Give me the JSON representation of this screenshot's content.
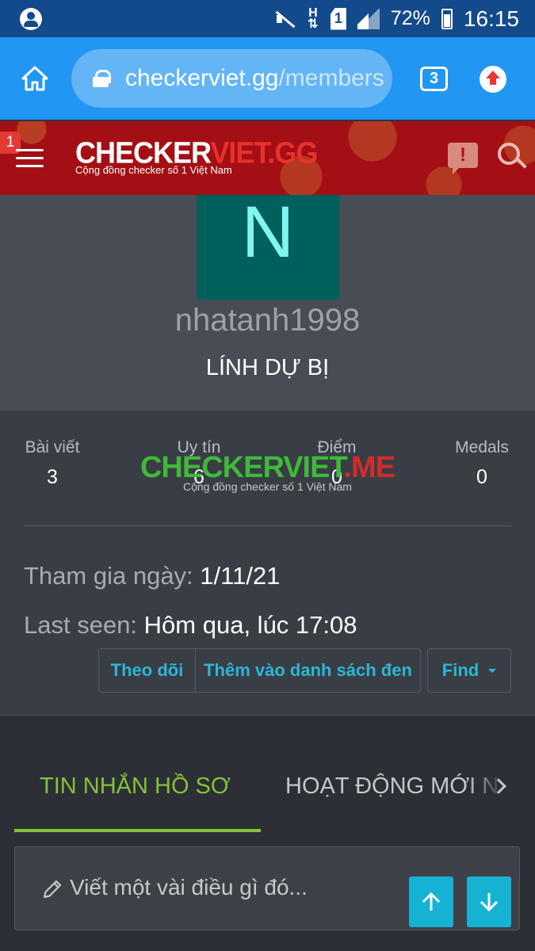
{
  "statusbar": {
    "battery": "72%",
    "time": "16:15",
    "network_h": "H",
    "sim_slot": "1"
  },
  "browser": {
    "url_host": "checkerviet.gg",
    "url_path": "/members",
    "tab_count": "3"
  },
  "header": {
    "notification_count": "1",
    "logo_white": "CHECKER",
    "logo_red": "VIET.GG",
    "logo_tagline": "Cộng đồng checker số 1 Việt Nam"
  },
  "profile": {
    "avatar_letter": "N",
    "username": "nhatanh1998",
    "rank": "LÍNH DỰ BỊ",
    "stats": [
      {
        "label": "Bài viết",
        "value": "3"
      },
      {
        "label": "Uy tín",
        "value": "6"
      },
      {
        "label": "Điểm",
        "value": "0"
      },
      {
        "label": "Medals",
        "value": "0"
      }
    ],
    "joined_label": "Tham gia ngày:",
    "joined_value": "1/11/21",
    "last_seen_label": "Last seen:",
    "last_seen_value": "Hôm qua, lúc 17:08"
  },
  "watermark": {
    "main_green": "CHECKERVIET",
    "main_red": ".ME",
    "sub": "Cộng đồng checker số 1 Việt Nam"
  },
  "actions": {
    "follow": "Theo dõi",
    "block": "Thêm vào danh sách đen",
    "find": "Find"
  },
  "tabs": {
    "active": "TIN NHẮN HỒ SƠ",
    "next": "HOẠT ĐỘNG MỚI N"
  },
  "composer": {
    "placeholder": "Viết một vài điều gì đó..."
  },
  "colors": {
    "browser_blue": "#2196f3",
    "header_red": "#a30f15",
    "accent_green": "#86c13a",
    "link_cyan": "#2ab7d8",
    "avatar_teal": "#00615c"
  }
}
